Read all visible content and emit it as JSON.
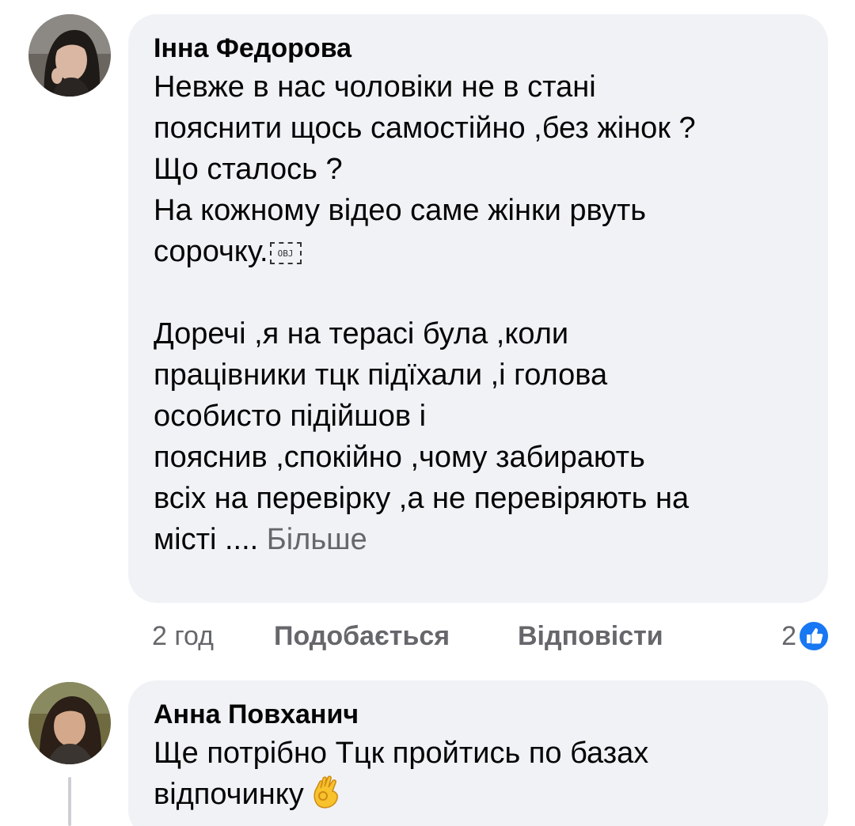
{
  "comments": [
    {
      "author": "Інна Федорова",
      "lines": [
        "Невже в нас чоловіки не в стані",
        "пояснити щось самостійно ,без жінок ?",
        "Що сталось ?",
        "На кожному відео саме жінки рвуть",
        "сорочку."
      ],
      "obj_placeholder": "OBJ",
      "lines2": [
        "Доречі ,я на терасі була ,коли",
        "працівники тцк підїхали ,і голова",
        "особисто підійшов і",
        "пояснив ,спокійно ,чому забирають",
        "всіх на перевірку ,а не перевіряють на"
      ],
      "last_line": "місті ....",
      "more_label": "Більше",
      "time": "2 год",
      "like_label": "Подобається",
      "reply_label": "Відповісти",
      "reaction_count": "2",
      "reaction_icon": "like-icon",
      "accent_color": "#1877f2"
    },
    {
      "author": "Анна Повханич",
      "lines": [
        "Ще потрібно Тцк пройтись  по базах",
        "відпочинку"
      ],
      "emoji": "ok-hand-emoji"
    }
  ]
}
